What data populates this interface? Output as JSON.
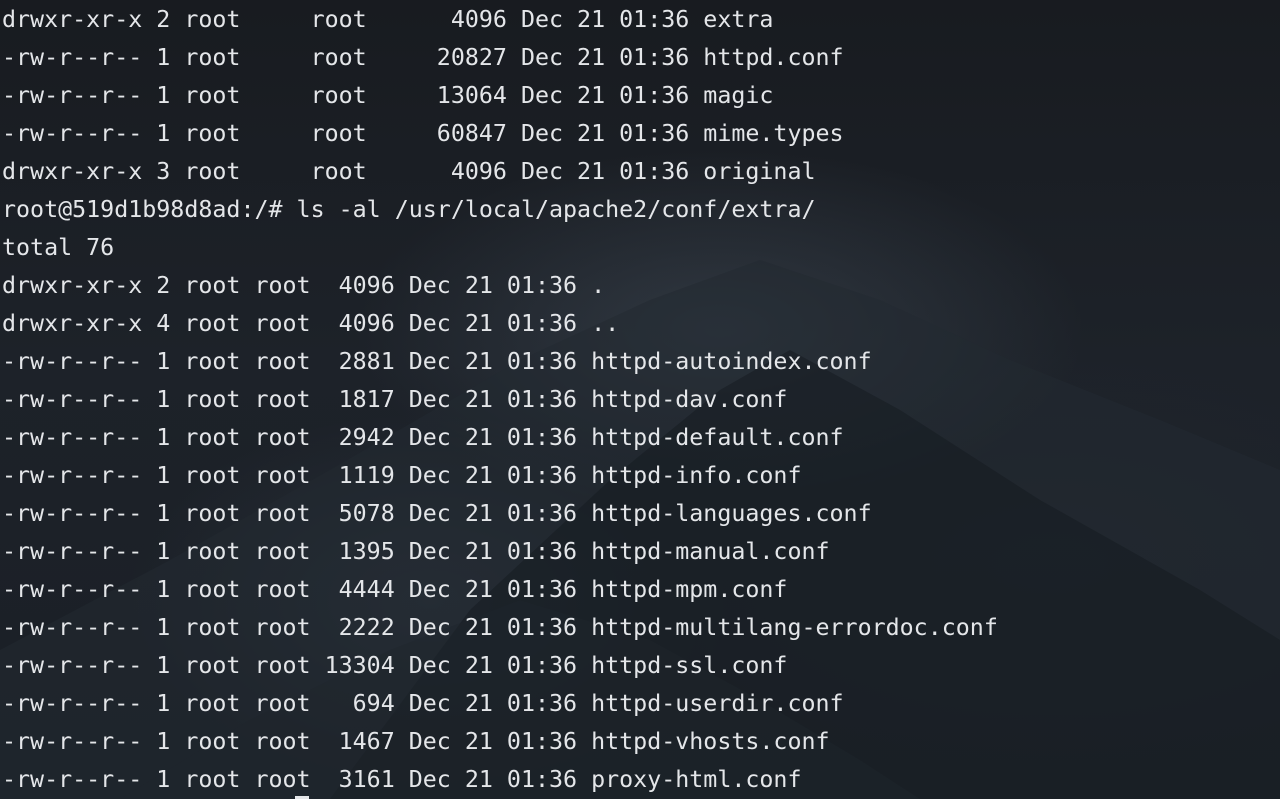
{
  "terminal": {
    "lines": [
      "drwxr-xr-x 2 root     root      4096 Dec 21 01:36 extra",
      "-rw-r--r-- 1 root     root     20827 Dec 21 01:36 httpd.conf",
      "-rw-r--r-- 1 root     root     13064 Dec 21 01:36 magic",
      "-rw-r--r-- 1 root     root     60847 Dec 21 01:36 mime.types",
      "drwxr-xr-x 3 root     root      4096 Dec 21 01:36 original",
      "root@519d1b98d8ad:/# ls -al /usr/local/apache2/conf/extra/",
      "total 76",
      "drwxr-xr-x 2 root root  4096 Dec 21 01:36 .",
      "drwxr-xr-x 4 root root  4096 Dec 21 01:36 ..",
      "-rw-r--r-- 1 root root  2881 Dec 21 01:36 httpd-autoindex.conf",
      "-rw-r--r-- 1 root root  1817 Dec 21 01:36 httpd-dav.conf",
      "-rw-r--r-- 1 root root  2942 Dec 21 01:36 httpd-default.conf",
      "-rw-r--r-- 1 root root  1119 Dec 21 01:36 httpd-info.conf",
      "-rw-r--r-- 1 root root  5078 Dec 21 01:36 httpd-languages.conf",
      "-rw-r--r-- 1 root root  1395 Dec 21 01:36 httpd-manual.conf",
      "-rw-r--r-- 1 root root  4444 Dec 21 01:36 httpd-mpm.conf",
      "-rw-r--r-- 1 root root  2222 Dec 21 01:36 httpd-multilang-errordoc.conf",
      "-rw-r--r-- 1 root root 13304 Dec 21 01:36 httpd-ssl.conf",
      "-rw-r--r-- 1 root root   694 Dec 21 01:36 httpd-userdir.conf",
      "-rw-r--r-- 1 root root  1467 Dec 21 01:36 httpd-vhosts.conf",
      "-rw-r--r-- 1 root root  3161 Dec 21 01:36 proxy-html.conf"
    ]
  },
  "colors": {
    "foreground": "#e4e6e9",
    "background": "#1b2027"
  }
}
